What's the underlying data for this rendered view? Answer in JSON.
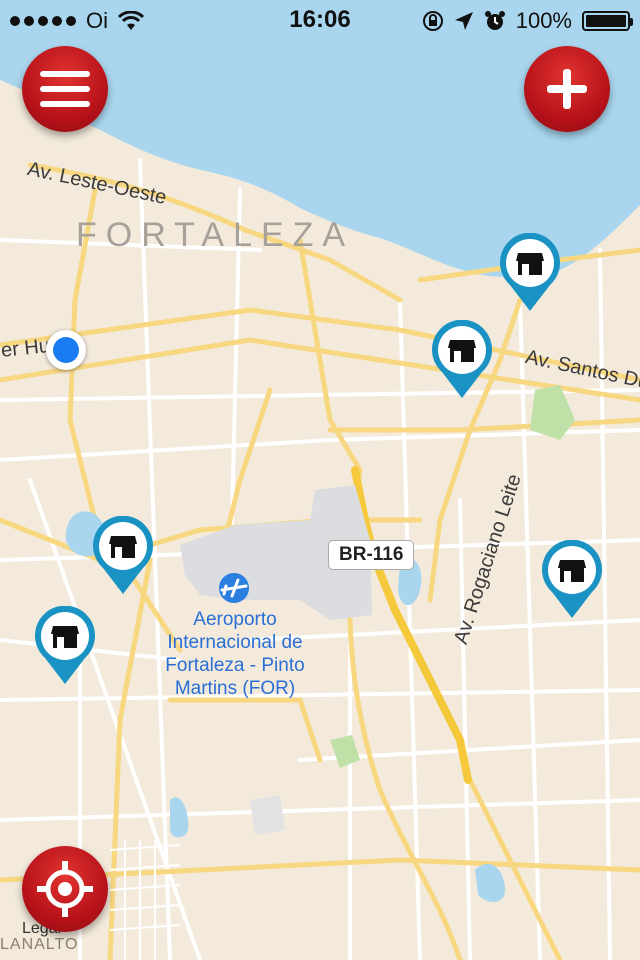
{
  "status_bar": {
    "carrier": "Oi",
    "time": "16:06",
    "battery": "100%"
  },
  "map": {
    "city_label": "FORTALEZA",
    "streets": [
      "Av. Leste-Oeste",
      "er Hu",
      "Av. Santos Du",
      "Av. Rogaciano Leite"
    ],
    "highway_shield": "BR-116",
    "airport": "Aeroporto Internacional de Fortaleza - Pinto Martins (FOR)",
    "legal": "Legal",
    "district": "LANALTO"
  },
  "buttons": {
    "menu_icon": "hamburger-icon",
    "add_icon": "plus-icon",
    "locate_icon": "crosshair-icon"
  },
  "colors": {
    "accent": "#c4161c",
    "pin": "#1a93c4",
    "water": "#a9d6ee",
    "land": "#f3eadb",
    "road": "#ffffff",
    "major_road": "#f7d780",
    "highway": "#f6c93c",
    "user_location": "#1a7cf2"
  }
}
